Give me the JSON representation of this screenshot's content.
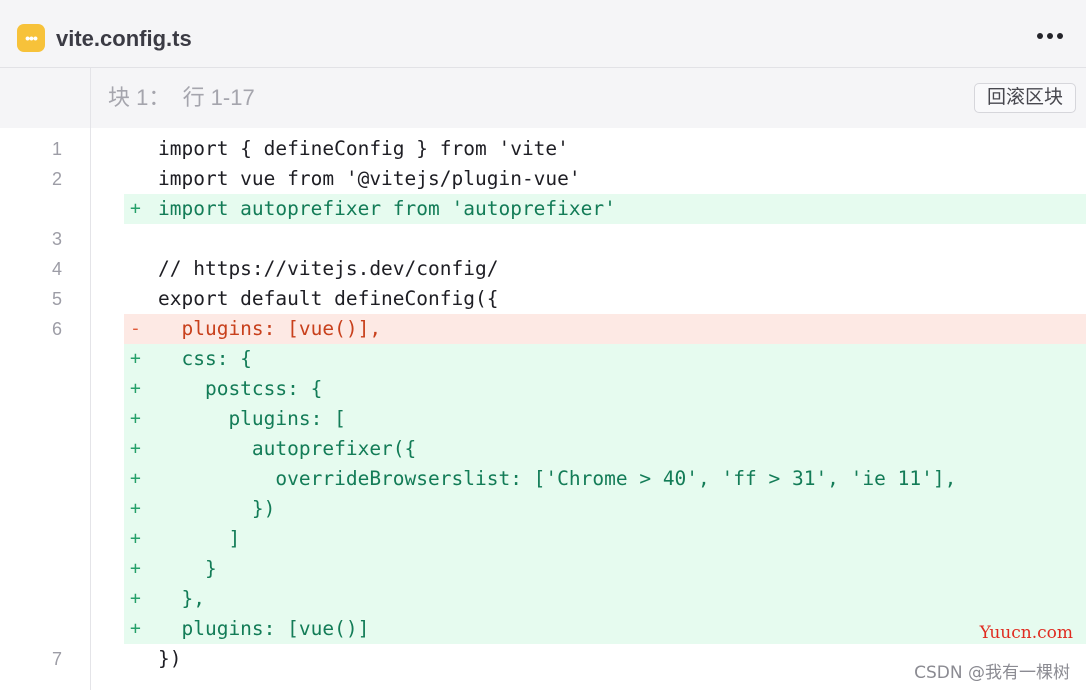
{
  "file": {
    "name": "vite.config.ts",
    "icon": "ellipsis-file-icon",
    "accent": "#f7c23a"
  },
  "hunk": {
    "label": "块 1：  行 1-17",
    "revert_label": "回滚区块"
  },
  "lines": [
    {
      "type": "context",
      "num": "1",
      "marker": "",
      "text": "import { defineConfig } from 'vite'"
    },
    {
      "type": "context",
      "num": "2",
      "marker": "",
      "text": "import vue from '@vitejs/plugin-vue'"
    },
    {
      "type": "added",
      "num": "",
      "marker": "+",
      "text": "import autoprefixer from 'autoprefixer'"
    },
    {
      "type": "context",
      "num": "3",
      "marker": "",
      "text": ""
    },
    {
      "type": "context",
      "num": "4",
      "marker": "",
      "text": "// https://vitejs.dev/config/"
    },
    {
      "type": "context",
      "num": "5",
      "marker": "",
      "text": "export default defineConfig({"
    },
    {
      "type": "removed",
      "num": "6",
      "marker": "-",
      "text": "  plugins: [vue()],"
    },
    {
      "type": "added",
      "num": "",
      "marker": "+",
      "text": "  css: {"
    },
    {
      "type": "added",
      "num": "",
      "marker": "+",
      "text": "    postcss: {"
    },
    {
      "type": "added",
      "num": "",
      "marker": "+",
      "text": "      plugins: ["
    },
    {
      "type": "added",
      "num": "",
      "marker": "+",
      "text": "        autoprefixer({"
    },
    {
      "type": "added",
      "num": "",
      "marker": "+",
      "text": "          overrideBrowserslist: ['Chrome > 40', 'ff > 31', 'ie 11'],"
    },
    {
      "type": "added",
      "num": "",
      "marker": "+",
      "text": "        })"
    },
    {
      "type": "added",
      "num": "",
      "marker": "+",
      "text": "      ]"
    },
    {
      "type": "added",
      "num": "",
      "marker": "+",
      "text": "    }"
    },
    {
      "type": "added",
      "num": "",
      "marker": "+",
      "text": "  },"
    },
    {
      "type": "added",
      "num": "",
      "marker": "+",
      "text": "  plugins: [vue()]"
    },
    {
      "type": "context",
      "num": "7",
      "marker": "",
      "text": "})"
    }
  ],
  "colors": {
    "added_bg": "#e6fbef",
    "removed_bg": "#fde9e4",
    "added_text": "#137c57",
    "removed_text": "#c8401c"
  },
  "watermarks": {
    "site": "Yuucn.com",
    "author": "CSDN @我有一棵树"
  }
}
